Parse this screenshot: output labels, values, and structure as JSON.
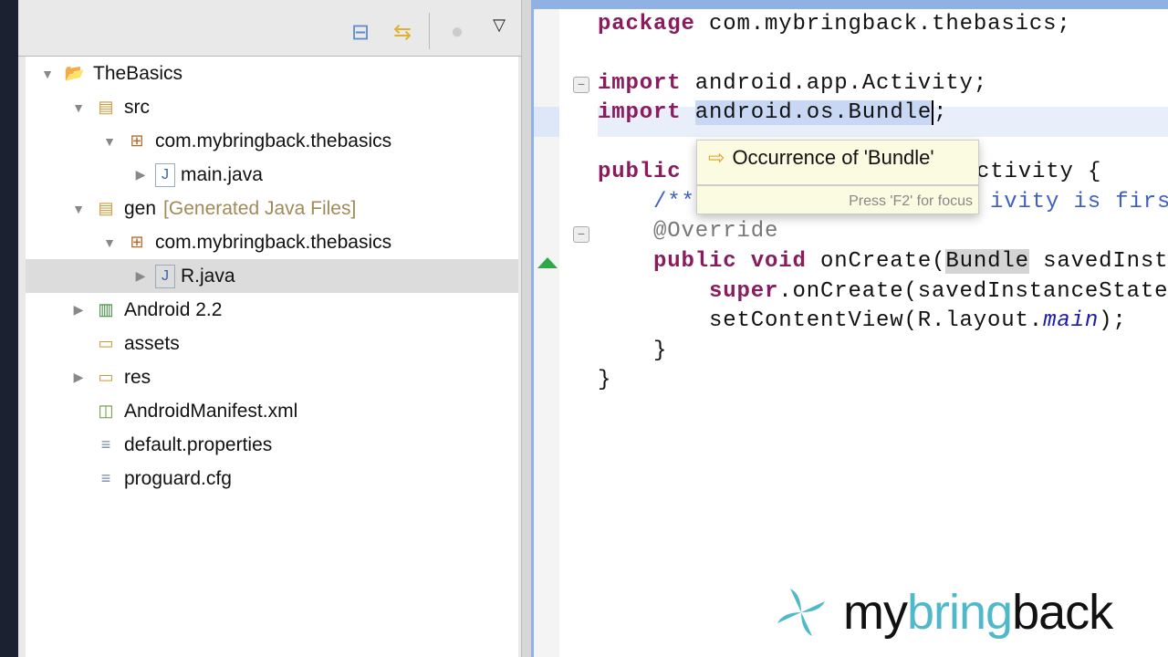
{
  "toolbar": {
    "icons": [
      "collapse-all-icon",
      "link-with-editor-icon",
      "disabled-filter-icon",
      "view-menu-icon"
    ]
  },
  "tree": [
    {
      "label": "TheBasics",
      "depth": 0,
      "toggle": "▼",
      "icon": "project-icon"
    },
    {
      "label": "src",
      "depth": 1,
      "toggle": "▼",
      "icon": "source-folder-icon"
    },
    {
      "label": "com.mybringback.thebasics",
      "depth": 2,
      "toggle": "▼",
      "icon": "package-icon"
    },
    {
      "label": "main.java",
      "depth": 3,
      "toggle": "▶",
      "icon": "java-file-icon"
    },
    {
      "label": "gen",
      "decoration": "[Generated Java Files]",
      "depth": 1,
      "toggle": "▼",
      "icon": "source-folder-icon"
    },
    {
      "label": "com.mybringback.thebasics",
      "depth": 2,
      "toggle": "▼",
      "icon": "package-icon"
    },
    {
      "label": "R.java",
      "depth": 3,
      "toggle": "▶",
      "icon": "java-file-icon",
      "selected": true
    },
    {
      "label": "Android 2.2",
      "depth": 1,
      "toggle": "▶",
      "icon": "library-icon"
    },
    {
      "label": "assets",
      "depth": 1,
      "toggle": "",
      "icon": "folder-icon"
    },
    {
      "label": "res",
      "depth": 1,
      "toggle": "▶",
      "icon": "folder-icon"
    },
    {
      "label": "AndroidManifest.xml",
      "depth": 1,
      "toggle": "",
      "icon": "xml-file-icon"
    },
    {
      "label": "default.properties",
      "depth": 1,
      "toggle": "",
      "icon": "text-file-icon"
    },
    {
      "label": "proguard.cfg",
      "depth": 1,
      "toggle": "",
      "icon": "text-file-icon"
    }
  ],
  "code": {
    "l1_kw": "package",
    "l1_rest": " com.mybringback.thebasics;",
    "l2_kw": "import",
    "l2_rest": " android.app.Activity;",
    "l3_kw": "import",
    "l3_sel": "android.os.Bundle",
    "l3_end": ";",
    "l4_kw": "public",
    "l4_tail": "ctivity {",
    "l5_cm": "/**",
    "l5_tail": "ivity is first",
    "l6": "@Override",
    "l7_kw1": "public",
    "l7_kw2": "void",
    "l7_a": " onCreate(",
    "l7_hl": "Bundle",
    "l7_b": " savedInsta",
    "l8_kw": "super",
    "l8_rest": ".onCreate(savedInstanceState)",
    "l9_a": "setContentView(R.layout.",
    "l9_it": "main",
    "l9_b": ");",
    "l10": "}",
    "l11": "}"
  },
  "tooltip": {
    "title": "Occurrence of 'Bundle'",
    "hint": "Press 'F2' for focus"
  },
  "logo": {
    "part1": "my",
    "part2": "bring",
    "part3": "back"
  },
  "colors": {
    "keyword": "#8a1b5c",
    "comment": "#3f5fbf",
    "accent": "#4fb9c9"
  }
}
